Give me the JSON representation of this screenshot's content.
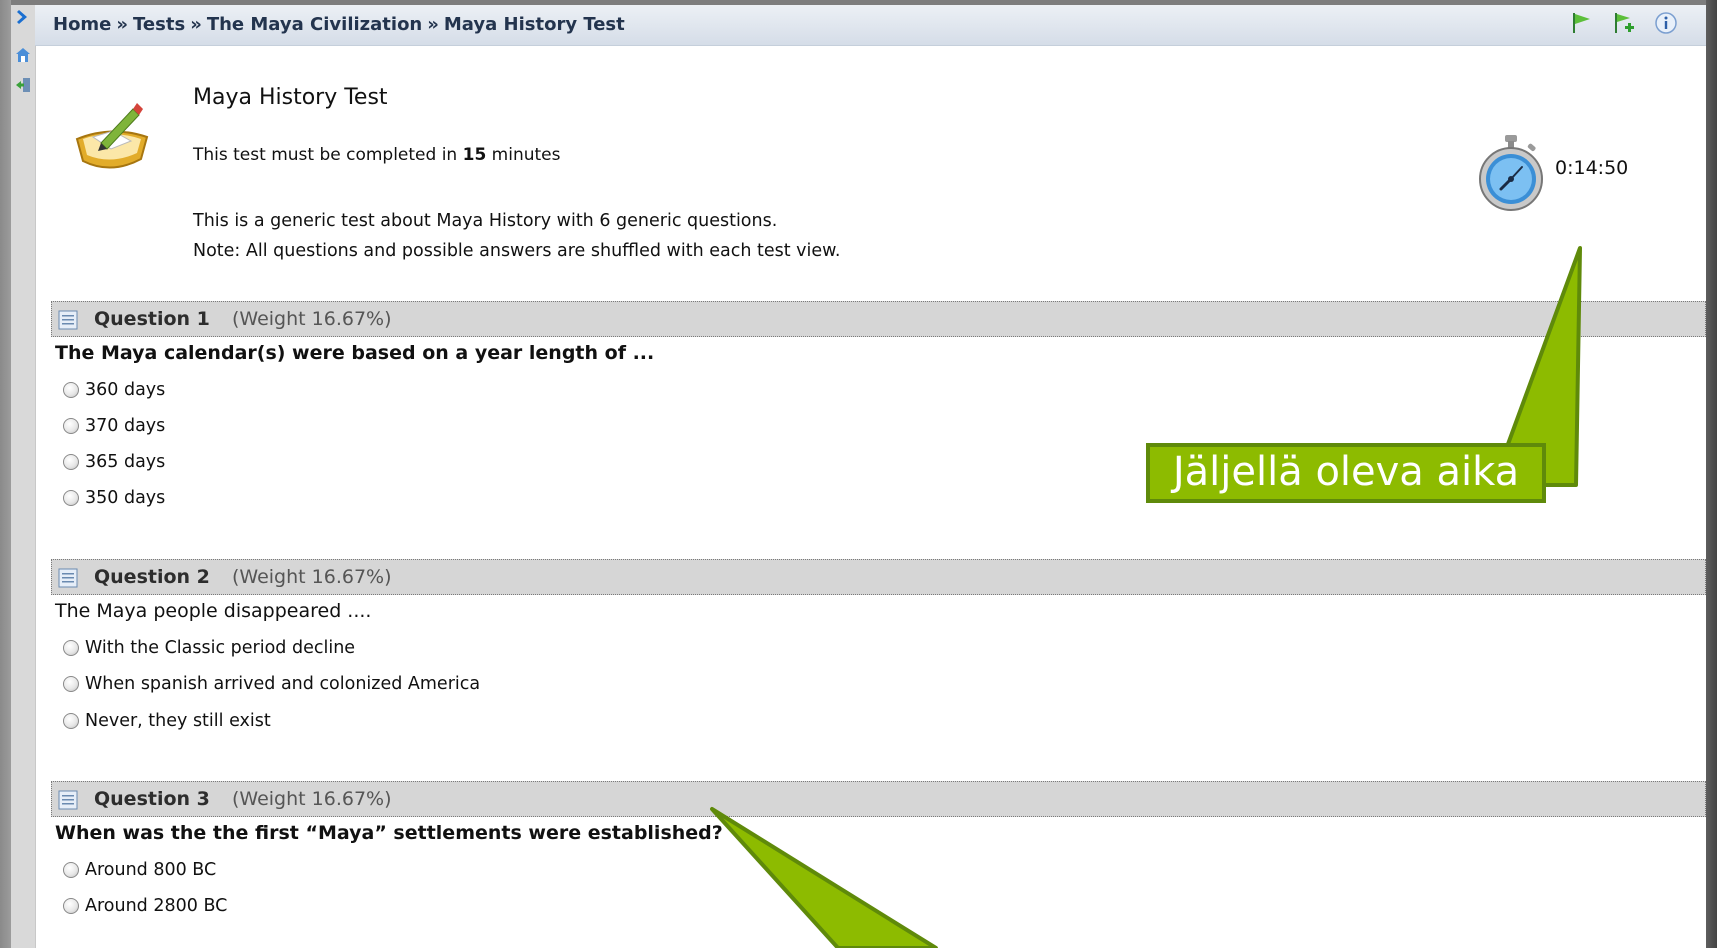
{
  "breadcrumb": {
    "items": [
      "Home",
      "Tests",
      "The Maya Civilization",
      "Maya History Test"
    ],
    "separator": "»"
  },
  "topbar_icons": [
    "flag-icon",
    "flag-add-icon",
    "info-icon"
  ],
  "sidebar_icons": [
    "home-icon",
    "exit-icon"
  ],
  "test": {
    "title": "Maya History Test",
    "time_prefix": "This test must be completed in ",
    "time_value": "15",
    "time_suffix": " minutes",
    "description_line1": "This is a generic test about Maya History with 6 generic questions.",
    "description_line2": "Note: All questions and possible answers are shuffled with each test view."
  },
  "timer": {
    "remaining": "0:14:50"
  },
  "questions": [
    {
      "label": "Question 1",
      "weight": "(Weight 16.67%)",
      "text": "The Maya calendar(s) were based on a year length of ...",
      "options": [
        "360 days",
        "370 days",
        "365 days",
        "350 days"
      ]
    },
    {
      "label": "Question 2",
      "weight": "(Weight 16.67%)",
      "text": "The Maya people disappeared ....",
      "options": [
        "With the Classic period decline",
        "When spanish arrived and colonized America",
        "Never, they still exist"
      ]
    },
    {
      "label": "Question 3",
      "weight": "(Weight 16.67%)",
      "text": "When was the the first “Maya” settlements were established?",
      "options": [
        "Around 800 BC",
        "Around 2800 BC"
      ]
    }
  ],
  "callout": {
    "text": "Jäljellä oleva aika"
  },
  "colors": {
    "callout_fill": "#8dbb00",
    "callout_border": "#5f8a0a",
    "question_header": "#d6d6d6"
  }
}
